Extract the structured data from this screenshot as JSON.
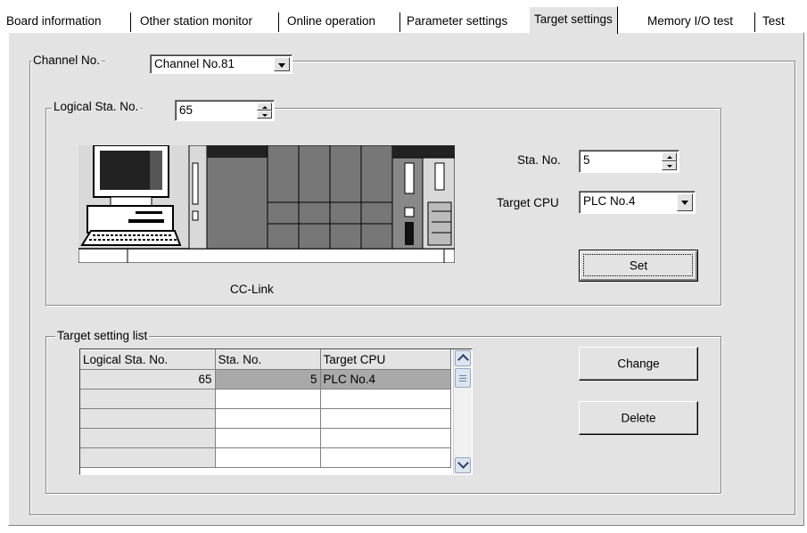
{
  "tabs": [
    {
      "label": "Board information",
      "active": false
    },
    {
      "label": "Other station monitor",
      "active": false
    },
    {
      "label": "Online operation",
      "active": false
    },
    {
      "label": "Parameter settings",
      "active": false
    },
    {
      "label": "Target settings",
      "active": true
    },
    {
      "label": "Memory I/O test",
      "active": false
    },
    {
      "label": "Test",
      "active": false
    }
  ],
  "channel": {
    "label": "Channel No.",
    "value": "Channel No.81"
  },
  "logical": {
    "label": "Logical Sta. No.",
    "value": "65"
  },
  "network_caption": "CC-Link",
  "sta_no": {
    "label": "Sta. No.",
    "value": "5"
  },
  "target_cpu": {
    "label": "Target CPU",
    "value": "PLC No.4"
  },
  "set_button": "Set",
  "target_list": {
    "label": "Target setting list",
    "columns": [
      "Logical Sta. No.",
      "Sta. No.",
      "Target CPU"
    ],
    "rows": [
      [
        "65",
        "5",
        "PLC No.4"
      ],
      [
        "",
        "",
        ""
      ],
      [
        "",
        "",
        ""
      ],
      [
        "",
        "",
        ""
      ],
      [
        "",
        "",
        ""
      ]
    ]
  },
  "change_button": "Change",
  "delete_button": "Delete"
}
